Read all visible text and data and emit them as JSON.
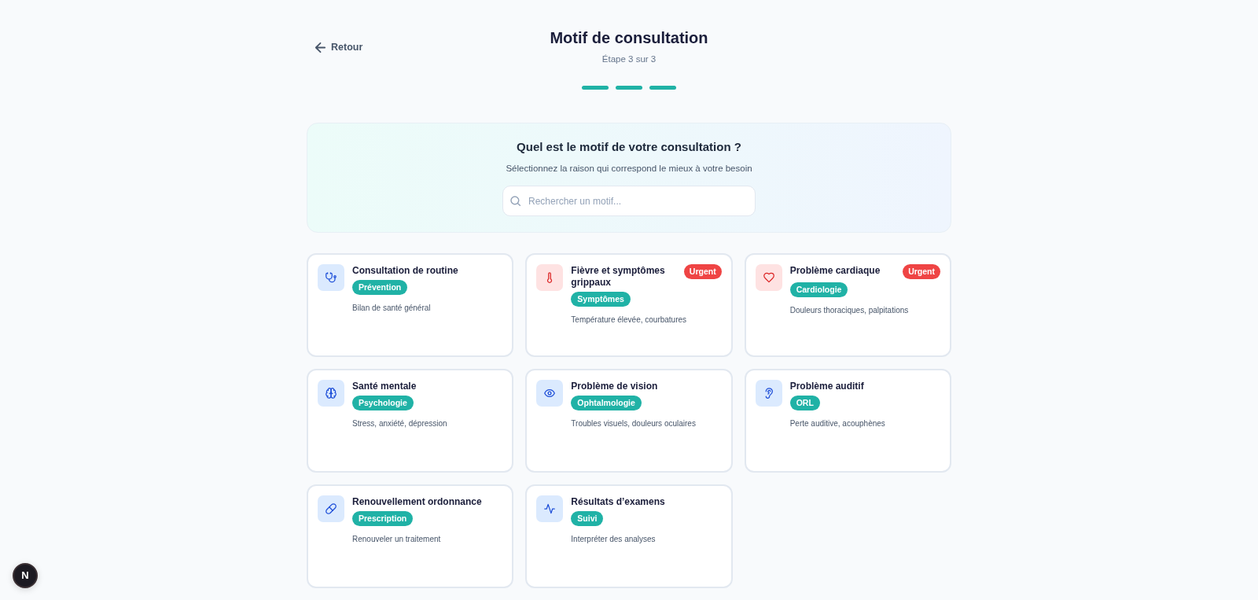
{
  "header": {
    "back_link": "Retour",
    "title": "Motif de consultation",
    "step": "Étape 3 sur 3"
  },
  "progress": {
    "steps": [
      {
        "done": true
      },
      {
        "done": true
      },
      {
        "done": true
      }
    ]
  },
  "intro": {
    "heading": "Quel est le motif de votre consultation ?",
    "subheading": "Sélectionnez la raison qui correspond le mieux à votre besoin",
    "search": {
      "placeholder": "Rechercher un motif..."
    }
  },
  "reasons": [
    {
      "title": "Consultation de routine",
      "category": "Prévention",
      "description": "Bilan de santé général",
      "urgent": false,
      "selected": false
    },
    {
      "title": "Fièvre et symptômes grippaux",
      "category": "Symptômes",
      "description": "Température élevée, courbatures",
      "urgent": true,
      "urgent_label": "Urgent",
      "selected": false
    },
    {
      "title": "Problème cardiaque",
      "category": "Cardiologie",
      "description": "Douleurs thoraciques, palpitations",
      "urgent": true,
      "urgent_label": "Urgent",
      "selected": false
    },
    {
      "title": "Santé mentale",
      "category": "Psychologie",
      "description": "Stress, anxiété, dépression",
      "urgent": false,
      "selected": false
    },
    {
      "title": "Problème de vision",
      "category": "Ophtalmologie",
      "description": "Troubles visuels, douleurs oculaires",
      "urgent": false,
      "selected": false
    },
    {
      "title": "Problème auditif",
      "category": "ORL",
      "description": "Perte auditive, acouphènes",
      "urgent": false,
      "selected": false
    },
    {
      "title": "Renouvellement ordonnance",
      "category": "Prescription",
      "description": "Renouveler un traitement",
      "urgent": false,
      "selected": false
    },
    {
      "title": "Résultats d’examens",
      "category": "Suivi",
      "description": "Interpréter des analyses",
      "urgent": false,
      "selected": false
    }
  ],
  "dev_badge": {
    "label": "N"
  }
}
